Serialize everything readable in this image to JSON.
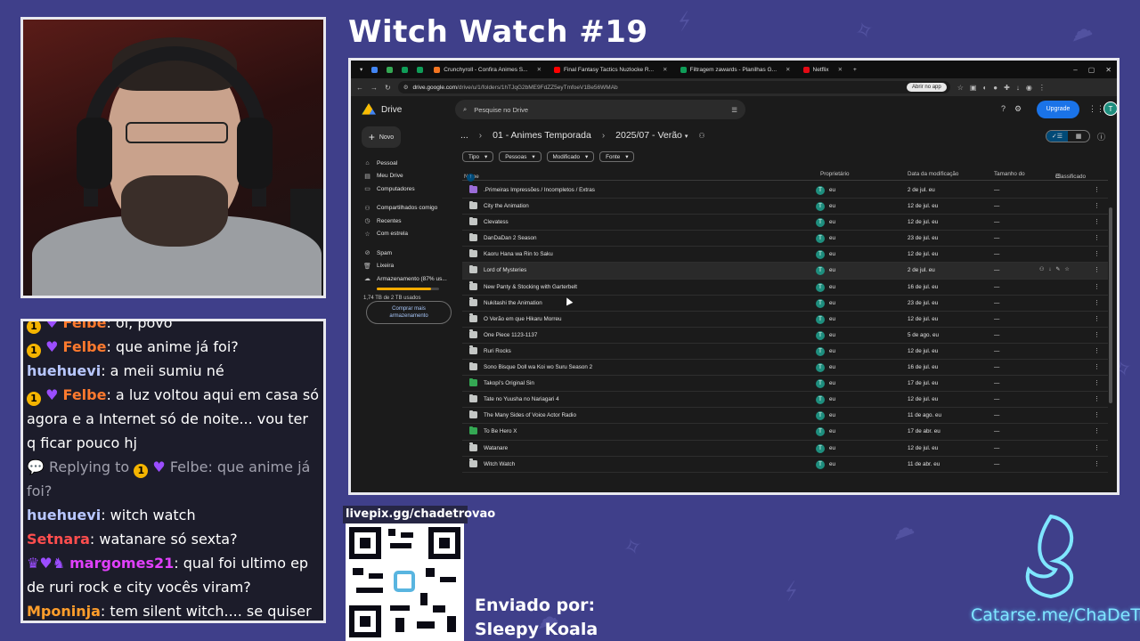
{
  "stream": {
    "title": "Witch Watch #19",
    "qr_label": "livepix.gg/chadetrovao",
    "sent_by_label": "Enviado por:",
    "sent_by_name": "Sleepy Koala",
    "catarse": "Catarse.me/ChaDeTrovao"
  },
  "chat": {
    "messages": [
      {
        "badge": "1",
        "user": "Felbe",
        "text": "oi, povo"
      },
      {
        "badge": "1",
        "user": "Felbe",
        "text": "que anime já foi?"
      },
      {
        "user": "huehuevi",
        "text": "a meii sumiu né"
      },
      {
        "badge": "1",
        "user": "Felbe",
        "text": "a luz voltou aqui em casa só agora e a Internet só de noite... vou ter q ficar pouco hj"
      },
      {
        "reply_prefix": "Replying to",
        "badge": "1",
        "user": "Felbe",
        "text": "que anime já foi?"
      },
      {
        "user": "huehuevi",
        "text": "witch watch"
      },
      {
        "user": "Setnara",
        "text": "watanare só sexta?"
      },
      {
        "user": "margomes21",
        "text": "qual foi ultimo ep de ruri rock e city vocês viram?"
      },
      {
        "user": "Mponinja",
        "text": "tem silent witch.... se quiser manter na mesma temática de bruxa....."
      }
    ]
  },
  "browser": {
    "tabs": [
      {
        "label": "Crunchyroll - Confira Animes S...",
        "color": "#f47521"
      },
      {
        "label": "Final Fantasy Tactics Nuzlocke R...",
        "color": "#ff0000"
      },
      {
        "label": "Filtragem zawards - Planilhas G...",
        "color": "#0f9d58"
      },
      {
        "label": "Netflix",
        "color": "#e50914"
      }
    ],
    "url_host": "drive.google.com",
    "url_path": "/drive/u/1/folders/1hTJqG2bME9FdZZ5eyTmfoeV1Be56WMAb",
    "open_app": "Abrir no app"
  },
  "drive": {
    "logo": "Drive",
    "search_placeholder": "Pesquise no Drive",
    "upgrade": "Upgrade",
    "avatar": "T",
    "new_button": "Novo",
    "sidebar": {
      "items": [
        "Pessoal",
        "Meu Drive",
        "Computadores",
        "Compartilhados comigo",
        "Recentes",
        "Com estrela",
        "Spam",
        "Lixeira",
        "Armazenamento (87% us..."
      ],
      "storage_text": "1,74 TB de 2 TB usados",
      "storage_pct": 0.87,
      "buy_storage": "Comprar mais armazenamento"
    },
    "breadcrumb": [
      "...",
      "01 - Animes Temporada",
      "2025/07 - Verão"
    ],
    "filters": [
      "Tipo",
      "Pessoas",
      "Modificado",
      "Fonte"
    ],
    "columns": {
      "name": "Nome",
      "owner": "Proprietário",
      "modified": "Data da modificação",
      "size": "Tamanho do",
      "sort": "Classificado"
    },
    "files": [
      {
        "name": ".Primeiras Impressões / Incompletos / Extras",
        "owner": "eu",
        "modified": "2 de jul. eu",
        "size": "—",
        "color": "purple"
      },
      {
        "name": "City the Animation",
        "owner": "eu",
        "modified": "12 de jul. eu",
        "size": "—",
        "color": "gray"
      },
      {
        "name": "Clevatess",
        "owner": "eu",
        "modified": "12 de jul. eu",
        "size": "—",
        "color": "gray"
      },
      {
        "name": "DanDaDan 2 Season",
        "owner": "eu",
        "modified": "23 de jul. eu",
        "size": "—",
        "color": "gray"
      },
      {
        "name": "Kaoru Hana wa Rin to Saku",
        "owner": "eu",
        "modified": "12 de jul. eu",
        "size": "—",
        "color": "gray"
      },
      {
        "name": "Lord of Mysteries",
        "owner": "eu",
        "modified": "2 de jul. eu",
        "size": "—",
        "color": "gray",
        "hover": true
      },
      {
        "name": "New Panty & Stocking with Garterbelt",
        "owner": "eu",
        "modified": "16 de jul. eu",
        "size": "—",
        "color": "gray"
      },
      {
        "name": "Nukitashi the Animation",
        "owner": "eu",
        "modified": "23 de jul. eu",
        "size": "—",
        "color": "gray"
      },
      {
        "name": "O Verão em que Hikaru Morreu",
        "owner": "eu",
        "modified": "12 de jul. eu",
        "size": "—",
        "color": "gray"
      },
      {
        "name": "One Piece 1123-1137",
        "owner": "eu",
        "modified": "5 de ago. eu",
        "size": "—",
        "color": "gray"
      },
      {
        "name": "Ruri Rocks",
        "owner": "eu",
        "modified": "12 de jul. eu",
        "size": "—",
        "color": "gray"
      },
      {
        "name": "Sono Bisque Doll wa Koi wo Suru Season 2",
        "owner": "eu",
        "modified": "16 de jul. eu",
        "size": "—",
        "color": "gray"
      },
      {
        "name": "Takopi's Original Sin",
        "owner": "eu",
        "modified": "17 de jul. eu",
        "size": "—",
        "color": "green"
      },
      {
        "name": "Tate no Yuusha no Nariagari 4",
        "owner": "eu",
        "modified": "12 de jul. eu",
        "size": "—",
        "color": "gray"
      },
      {
        "name": "The Many Sides of Voice Actor Radio",
        "owner": "eu",
        "modified": "11 de ago. eu",
        "size": "—",
        "color": "gray"
      },
      {
        "name": "To Be Hero X",
        "owner": "eu",
        "modified": "17 de abr. eu",
        "size": "—",
        "color": "green"
      },
      {
        "name": "Watanare",
        "owner": "eu",
        "modified": "12 de jul. eu",
        "size": "—",
        "color": "gray"
      },
      {
        "name": "Witch Watch",
        "owner": "eu",
        "modified": "11 de abr. eu",
        "size": "—",
        "color": "gray"
      }
    ]
  }
}
